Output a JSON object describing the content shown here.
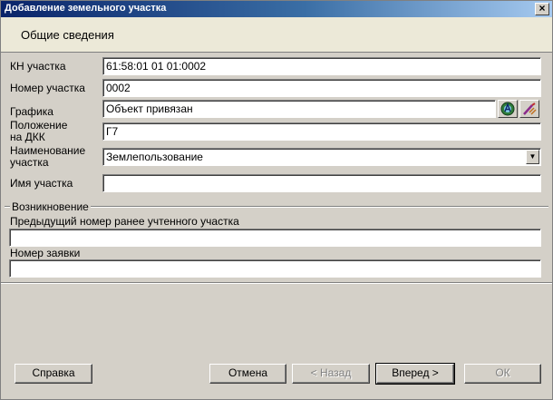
{
  "window": {
    "title": "Добавление земельного участка"
  },
  "header": {
    "title": "Общие сведения"
  },
  "form": {
    "kn_label": "КН участка",
    "kn_value": "61:58:01 01 01:0002",
    "number_label": "Номер участка",
    "number_value": "0002",
    "graphics_label": "Графика",
    "graphics_value": "Объект привязан",
    "position_label_line1": "Положение",
    "position_label_line2": "на ДКК",
    "position_value": "Г7",
    "name_label_line1": "Наименование",
    "name_label_line2": "участка",
    "name_value": "Землепользование",
    "plot_name_label": "Имя участка",
    "plot_name_value": ""
  },
  "origin": {
    "group_title": "Возникновение",
    "prev_number_label": "Предыдущий номер ранее учтенного участка",
    "prev_number_value": "",
    "request_label": "Номер заявки",
    "request_value": ""
  },
  "buttons": {
    "help": "Справка",
    "cancel": "Отмена",
    "back": "< Назад",
    "next": "Вперед >",
    "ok": "ОК"
  },
  "icons": {
    "close": "close-icon",
    "map_locate": "map-locate-icon",
    "edit_graphics": "edit-graphics-icon",
    "dropdown": "chevron-down-icon"
  }
}
